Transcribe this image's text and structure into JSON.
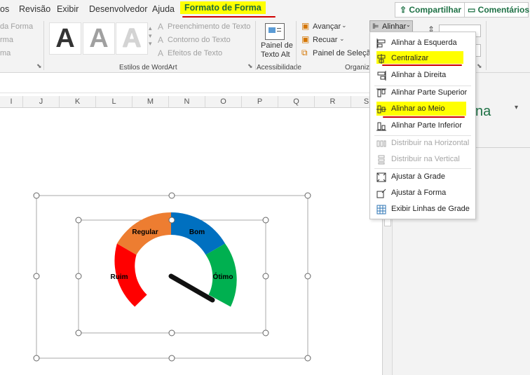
{
  "tabs": [
    "os",
    "Revisão",
    "Exibir",
    "Desenvolvedor",
    "Ajuda",
    "Formato de Forma"
  ],
  "share_button": "Compartilhar",
  "comments_button": "Comentários",
  "ribbon": {
    "shape_fill": "da Forma",
    "shape_outline": "rma",
    "shape_effects": "ma",
    "wordart_text_fill": "Preenchimento de Texto",
    "wordart_text_outline": "Contorno do Texto",
    "wordart_text_effects": "Efeitos de Texto",
    "wordart_group": "Estilos de WordArt",
    "alt_text_line1": "Painel de",
    "alt_text_line2": "Texto Alt",
    "accessibility_group": "Acessibilidade",
    "bring_forward": "Avançar",
    "send_backward": "Recuar",
    "selection_pane": "Painel de Seleção",
    "arrange_group": "Organiza",
    "align_button": "Alinhar",
    "wordart_letter": "A"
  },
  "columns": [
    "I",
    "J",
    "K",
    "L",
    "M",
    "N",
    "O",
    "P",
    "Q",
    "R",
    "S"
  ],
  "pane_title": "na",
  "gauge": {
    "bad": "Ruim",
    "fair": "Regular",
    "good": "Bom",
    "great": "Ótimo"
  },
  "align_menu": [
    {
      "label": "Alinhar à Esquerda",
      "enabled": true
    },
    {
      "label": "Centralizar",
      "enabled": true,
      "highlighted": true
    },
    {
      "label": "Alinhar à Direita",
      "enabled": true
    },
    {
      "label": "Alinhar Parte Superior",
      "enabled": true
    },
    {
      "label": "Alinhar ao Meio",
      "enabled": true,
      "highlighted": true
    },
    {
      "label": "Alinhar Parte Inferior",
      "enabled": true
    },
    {
      "label": "Distribuir na Horizontal",
      "enabled": false
    },
    {
      "label": "Distribuir na Vertical",
      "enabled": false
    },
    {
      "label": "Ajustar à Grade",
      "enabled": true
    },
    {
      "label": "Ajustar à Forma",
      "enabled": true
    },
    {
      "label": "Exibir Linhas de Grade",
      "enabled": true
    }
  ],
  "colors": {
    "accent": "#1e7145",
    "highlight": "#ffff00",
    "underline": "#d00000",
    "red": "#ff0000",
    "orange": "#ed7d31",
    "blue": "#0070c0",
    "green": "#00b050"
  }
}
